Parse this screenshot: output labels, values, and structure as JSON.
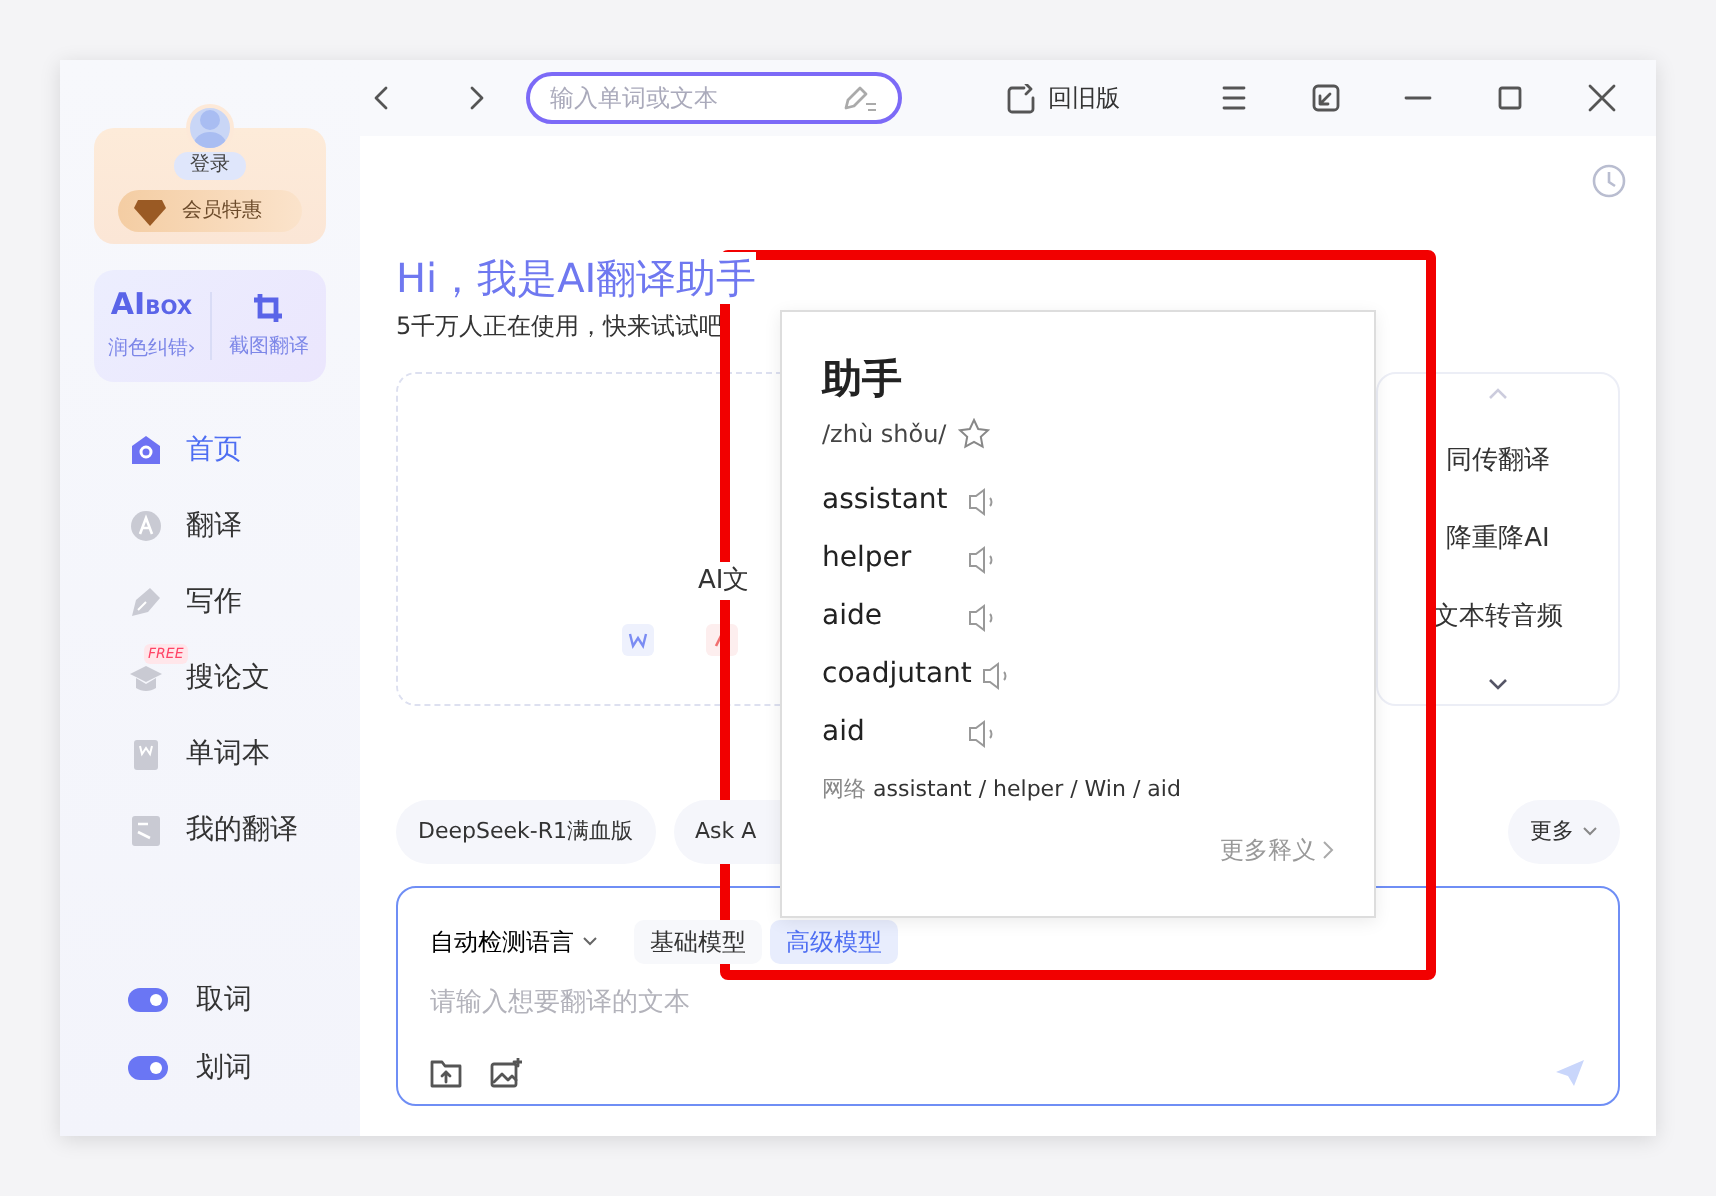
{
  "toolbar": {
    "search": {
      "placeholder": "输入单词或文本"
    },
    "old_version": "回旧版"
  },
  "sidebar": {
    "login": "登录",
    "vip": "会员特惠",
    "tools": [
      {
        "kind": "logo",
        "logo": "AI",
        "logo_sub": "BOX",
        "label": "润色纠错›"
      },
      {
        "kind": "crop",
        "label": "截图翻译"
      }
    ],
    "nav": [
      {
        "kind": "home",
        "label": "首页",
        "selected": true
      },
      {
        "kind": "translate",
        "label": "翻译",
        "selected": false
      },
      {
        "kind": "write",
        "label": "写作",
        "selected": false
      },
      {
        "kind": "papers",
        "label": "搜论文",
        "selected": false,
        "badge": "FREE"
      },
      {
        "kind": "wordbook",
        "label": "单词本",
        "selected": false
      },
      {
        "kind": "history",
        "label": "我的翻译",
        "selected": false
      }
    ],
    "toggles": [
      {
        "label": "取词",
        "on": true
      },
      {
        "label": "划词",
        "on": true
      }
    ]
  },
  "main": {
    "title": "Hi，我是AI翻译助手",
    "subtitle": "5千万人正在使用，快来试试吧",
    "doc_card": {
      "label": "AI文"
    },
    "side_tools": [
      "同传翻译",
      "降重降AI",
      "文本转音频"
    ],
    "chips": [
      {
        "kind": "plain",
        "label": "DeepSeek-R1满血版"
      },
      {
        "kind": "plain",
        "label": "Ask A"
      },
      {
        "kind": "dropdown",
        "label": "更多"
      }
    ],
    "input": {
      "language": "自动检测语言",
      "models": [
        {
          "label": "基础模型",
          "selected": false
        },
        {
          "label": "高级模型",
          "selected": true
        }
      ],
      "placeholder": "请输入想要翻译的文本"
    }
  },
  "popup": {
    "word": "助手",
    "pinyin": "/zhù shǒu/",
    "translations": [
      "assistant",
      "helper",
      "aide",
      "coadjutant",
      "aid"
    ],
    "web_label": "网络",
    "web": "assistant / helper / Win / aid",
    "more": "更多释义"
  },
  "annotation": {
    "kind": "rectangle"
  }
}
